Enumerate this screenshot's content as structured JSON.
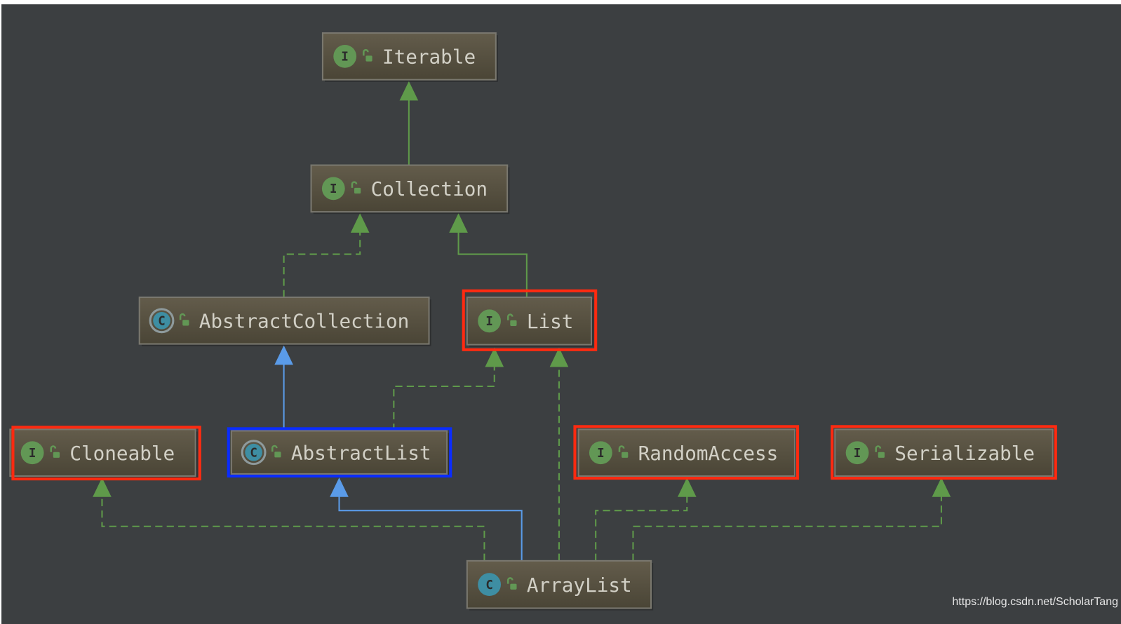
{
  "diagram": {
    "nodes": {
      "iterable": {
        "name": "Iterable",
        "kind": "interface",
        "icon": "I"
      },
      "collection": {
        "name": "Collection",
        "kind": "interface",
        "icon": "I"
      },
      "abstract_collection": {
        "name": "AbstractCollection",
        "kind": "abstract-class",
        "icon": "C"
      },
      "list": {
        "name": "List",
        "kind": "interface",
        "icon": "I",
        "highlight": "#ff2a10"
      },
      "cloneable": {
        "name": "Cloneable",
        "kind": "interface",
        "icon": "I",
        "highlight": "#ff2a10"
      },
      "abstract_list": {
        "name": "AbstractList",
        "kind": "abstract-class",
        "icon": "C",
        "highlight": "#0a2cff"
      },
      "random_access": {
        "name": "RandomAccess",
        "kind": "interface",
        "icon": "I",
        "highlight": "#ff2a10"
      },
      "serializable": {
        "name": "Serializable",
        "kind": "interface",
        "icon": "I",
        "highlight": "#ff2a10"
      },
      "array_list": {
        "name": "ArrayList",
        "kind": "class",
        "icon": "C"
      }
    },
    "edges": [
      {
        "from": "Collection",
        "to": "Iterable",
        "type": "extends",
        "style": "solid-green"
      },
      {
        "from": "AbstractCollection",
        "to": "Collection",
        "type": "implements",
        "style": "dashed-green"
      },
      {
        "from": "List",
        "to": "Collection",
        "type": "extends",
        "style": "solid-green"
      },
      {
        "from": "AbstractList",
        "to": "AbstractCollection",
        "type": "extends",
        "style": "solid-blue"
      },
      {
        "from": "AbstractList",
        "to": "List",
        "type": "implements",
        "style": "dashed-green"
      },
      {
        "from": "ArrayList",
        "to": "List",
        "type": "implements",
        "style": "dashed-green"
      },
      {
        "from": "ArrayList",
        "to": "AbstractList",
        "type": "extends",
        "style": "solid-blue"
      },
      {
        "from": "ArrayList",
        "to": "Cloneable",
        "type": "implements",
        "style": "dashed-green"
      },
      {
        "from": "ArrayList",
        "to": "RandomAccess",
        "type": "implements",
        "style": "dashed-green"
      },
      {
        "from": "ArrayList",
        "to": "Serializable",
        "type": "implements",
        "style": "dashed-green"
      }
    ],
    "colors": {
      "background": "#3c3f41",
      "interface_icon": "#629755",
      "class_icon": "#3e8ea3",
      "green_edge": "#5f9a4a",
      "blue_edge": "#5a9be8",
      "highlight_red": "#ff2a10",
      "highlight_blue": "#0a2cff"
    }
  },
  "watermark": "https://blog.csdn.net/ScholarTang"
}
